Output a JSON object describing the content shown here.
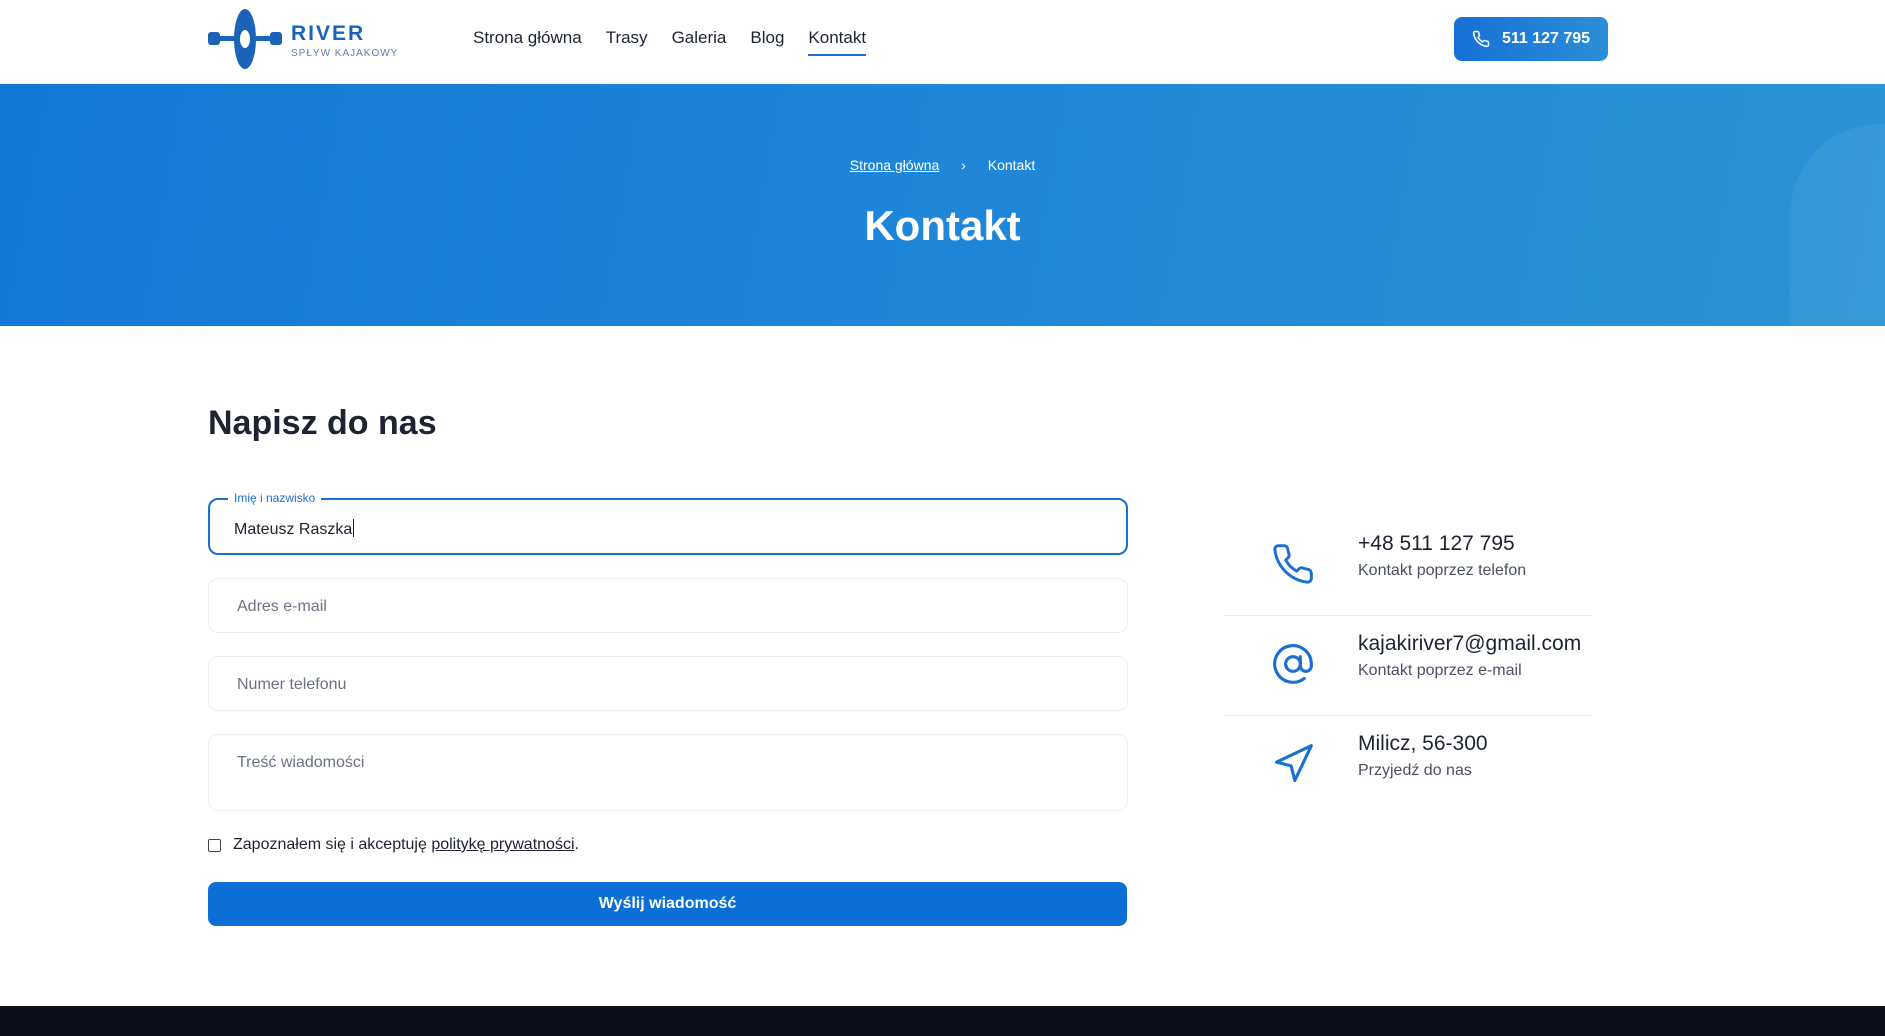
{
  "header": {
    "logo": {
      "title": "RIVER",
      "subtitle": "SPŁYW KAJAKOWY"
    },
    "nav": [
      {
        "label": "Strona główna",
        "active": false
      },
      {
        "label": "Trasy",
        "active": false
      },
      {
        "label": "Galeria",
        "active": false
      },
      {
        "label": "Blog",
        "active": false
      },
      {
        "label": "Kontakt",
        "active": true
      }
    ],
    "phone_button": "511 127 795"
  },
  "hero": {
    "breadcrumb": {
      "home": "Strona główna",
      "current": "Kontakt"
    },
    "title": "Kontakt"
  },
  "form": {
    "title": "Napisz do nas",
    "name_field": {
      "label": "Imię i nazwisko",
      "value": "Mateusz Raszka"
    },
    "email_field": {
      "placeholder": "Adres e-mail"
    },
    "phone_field": {
      "placeholder": "Numer telefonu"
    },
    "message_field": {
      "placeholder": "Treść wiadomości"
    },
    "consent": {
      "prefix": "Zapoznałem się i akceptuję ",
      "link": "politykę prywatności",
      "suffix": "."
    },
    "submit_label": "Wyślij wiadomość"
  },
  "contacts": [
    {
      "icon": "phone-icon",
      "main": "+48 511 127 795",
      "sub": "Kontakt poprzez telefon"
    },
    {
      "icon": "at-sign-icon",
      "main": "kajakiriver7@gmail.com",
      "sub": "Kontakt poprzez e-mail"
    },
    {
      "icon": "navigation-arrow-icon",
      "main": "Milicz, 56-300",
      "sub": "Przyjedź do nas"
    }
  ],
  "colors": {
    "primary": "#0b6fd5",
    "hero_start": "#1278d6",
    "hero_end": "#2a94d4",
    "footer": "#0b0e16"
  }
}
